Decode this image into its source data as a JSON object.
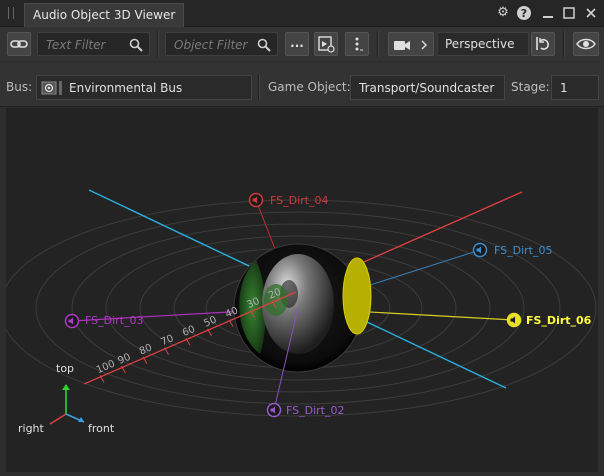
{
  "window": {
    "title": "Audio Object 3D Viewer"
  },
  "toolbar": {
    "text_filter_placeholder": "Text Filter",
    "object_filter_placeholder": "Object Filter",
    "more_label": "...",
    "view_mode": "Perspective"
  },
  "props": {
    "bus_label": "Bus:",
    "bus_value": "Environmental Bus",
    "game_object_label": "Game Object:",
    "game_object_value": "Transport/Soundcaster",
    "stage_label": "Stage:",
    "stage_value": "1"
  },
  "viewport": {
    "objects": [
      {
        "name": "FS_Dirt_04",
        "color": "#d23a3a",
        "selected": false
      },
      {
        "name": "FS_Dirt_05",
        "color": "#3a8fd2",
        "selected": false
      },
      {
        "name": "FS_Dirt_06",
        "color": "#e8e020",
        "selected": true
      },
      {
        "name": "FS_Dirt_03",
        "color": "#b23ac8",
        "selected": false
      },
      {
        "name": "FS_Dirt_02",
        "color": "#9a5ad0",
        "selected": false
      }
    ],
    "distance_ticks": [
      "20",
      "30",
      "40",
      "50",
      "60",
      "70",
      "80",
      "90",
      "100"
    ],
    "gizmo": {
      "top": "top",
      "right": "right",
      "front": "front"
    }
  },
  "colors": {
    "cyan_axis": "#2ab0e0",
    "red_axis": "#e04040",
    "yellow_cone": "#c8c000",
    "green_cone": "#2e7a2a"
  }
}
